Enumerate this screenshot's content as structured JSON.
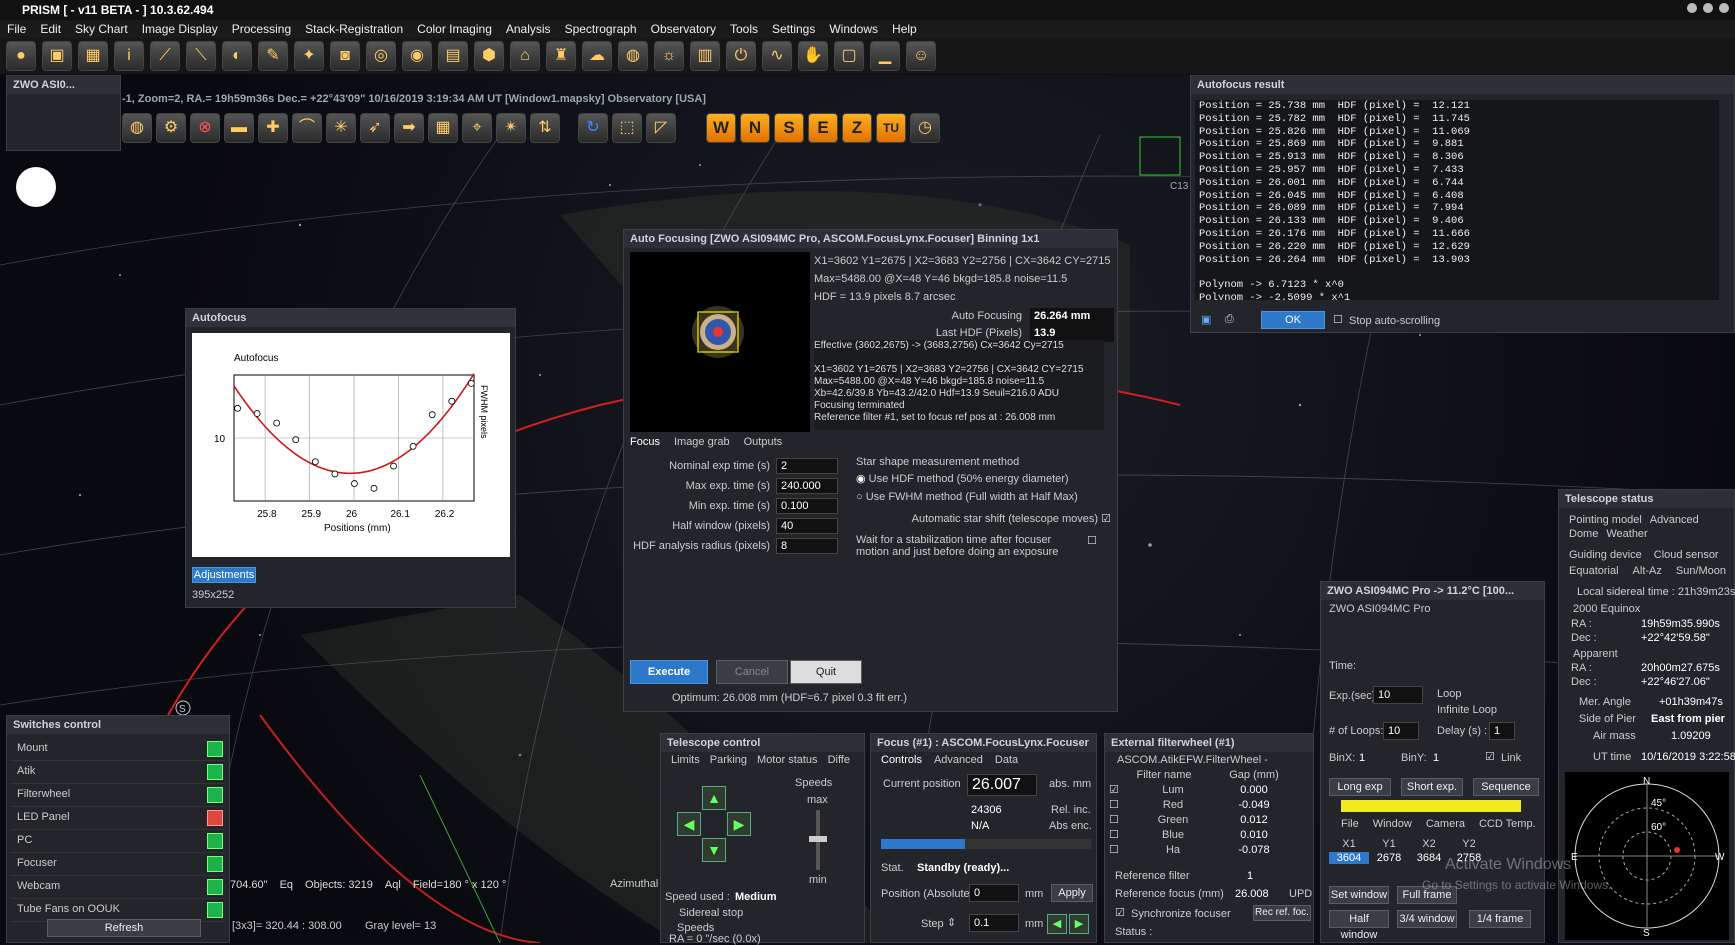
{
  "app": {
    "title": "PRISM [ - v11 BETA - ] 10.3.62.494"
  },
  "menu": [
    "File",
    "Edit",
    "Sky Chart",
    "Image Display",
    "Processing",
    "Stack-Registration",
    "Color Imaging",
    "Analysis",
    "Spectrograph",
    "Observatory",
    "Tools",
    "Settings",
    "Windows",
    "Help"
  ],
  "skychart": {
    "header": "-1, Zoom=2, RA.= 19h59m36s Dec.= +22°43'09\"  10/16/2019 3:19:34 AM UT [Window1.mapsky]  Observatory [USA]",
    "small_window_title": "ZWO ASI0...",
    "nav_letters": [
      "W",
      "N",
      "S",
      "E",
      "Z",
      "TU"
    ],
    "status": {
      "coord": "704.60\"",
      "proj": "Eq",
      "objects": "Objects: 3219",
      "aql": "Aql",
      "field": "Field=180 ° x 120 °",
      "azimuthal": "Azimuthal r",
      "xy": "[3x3]= 320.44 : 308.00",
      "gray": "Gray level= 13"
    },
    "label_c13": "C13",
    "label_s": "S"
  },
  "autofocus_plot": {
    "title": "Autofocus",
    "size": "395x252",
    "adjust_button": "Adjustments"
  },
  "chart_data": {
    "type": "scatter",
    "title": "Autofocus",
    "xlabel": "Positions (mm)",
    "ylabel": "FWHM pixels",
    "x": [
      25.738,
      25.782,
      25.826,
      25.869,
      25.913,
      25.957,
      26.001,
      26.045,
      26.089,
      26.133,
      26.176,
      26.22,
      26.264
    ],
    "y": [
      12.121,
      11.745,
      11.069,
      9.881,
      8.306,
      7.433,
      6.744,
      6.408,
      7.994,
      9.406,
      11.666,
      12.629,
      13.903
    ],
    "fit_curve": true,
    "xlim": [
      25.73,
      26.27
    ],
    "ylim": [
      5.5,
      14.5
    ],
    "xticks": [
      "25.8",
      "25.9",
      "26",
      "26.1",
      "26.2"
    ],
    "yticks": [
      "10"
    ]
  },
  "autofocus_dialog": {
    "title": "Auto Focusing [ZWO ASI094MC Pro, ASCOM.FocusLynx.Focuser] Binning 1x1",
    "info1": "X1=3602 Y1=2675 | X2=3683 Y2=2756 | CX=3642  CY=2715",
    "info2": "Max=5488.00  @X=48 Y=46  bkgd=185.8  noise=11.5",
    "info3": "HDF = 13.9 pixels  8.7 arcsec",
    "auto_label": "Auto Focusing",
    "auto_value": "26.264 mm",
    "hdf_label": "Last HDF (Pixels)",
    "hdf_value": "13.9",
    "log": [
      "Effective (3602,2675) -> (3683,2756) Cx=3642 Cy=2715",
      "",
      "X1=3602 Y1=2675 | X2=3683 Y2=2756 | CX=3642  CY=2715",
      "Max=5488.00  @X=48 Y=46  bkgd=185.8  noise=11.5",
      "Xb=42.6/39.8  Yb=43.2/42.0  Hdf=13.9  Seuil=216.0 ADU",
      "Focusing terminated",
      "Reference filter #1, set to focus ref pos at : 26.008 mm"
    ],
    "tabs": [
      "Focus",
      "Image grab",
      "Outputs"
    ],
    "params": [
      {
        "label": "Nominal exp time (s)",
        "value": "2"
      },
      {
        "label": "Max exp. time (s)",
        "value": "240.000"
      },
      {
        "label": "Min exp. time (s)",
        "value": "0.100"
      },
      {
        "label": "Half window (pixels)",
        "value": "40"
      },
      {
        "label": "HDF analysis radius (pixels)",
        "value": "8"
      }
    ],
    "method_title": "Star shape measurement method",
    "method_hdf": "Use HDF method (50% energy diameter)",
    "method_fwhm": "Use FWHM method (Full width at Half Max)",
    "auto_shift": "Automatic star shift (telescope moves)",
    "wait_text": "Wait for a stabilization time after focuser motion and just before doing an exposure",
    "execute": "Execute",
    "cancel": "Cancel",
    "quit": "Quit",
    "optimum": "Optimum: 26.008 mm (HDF=6.7 pixel 0.3 fit err.)"
  },
  "autofocus_result": {
    "title": "Autofocus result",
    "lines": [
      "Position = 25.738 mm  HDF (pixel) =  12.121",
      "Position = 25.782 mm  HDF (pixel) =  11.745",
      "Position = 25.826 mm  HDF (pixel) =  11.069",
      "Position = 25.869 mm  HDF (pixel) =  9.881",
      "Position = 25.913 mm  HDF (pixel) =  8.306",
      "Position = 25.957 mm  HDF (pixel) =  7.433",
      "Position = 26.001 mm  HDF (pixel) =  6.744",
      "Position = 26.045 mm  HDF (pixel) =  6.408",
      "Position = 26.089 mm  HDF (pixel) =  7.994",
      "Position = 26.133 mm  HDF (pixel) =  9.406",
      "Position = 26.176 mm  HDF (pixel) =  11.666",
      "Position = 26.220 mm  HDF (pixel) =  12.629",
      "Position = 26.264 mm  HDF (pixel) =  13.903",
      "",
      "Polynom -> 6.7123 * x^0",
      "Polynom -> -2.5099 * x^1"
    ],
    "ok": "OK",
    "stop_scroll": "Stop auto-scrolling"
  },
  "switches": {
    "title": "Switches control",
    "items": [
      {
        "name": "Mount",
        "state": "on"
      },
      {
        "name": "Atik",
        "state": "on"
      },
      {
        "name": "Filterwheel",
        "state": "on"
      },
      {
        "name": "LED Panel",
        "state": "off"
      },
      {
        "name": "PC",
        "state": "on"
      },
      {
        "name": "Focuser",
        "state": "on"
      },
      {
        "name": "Webcam",
        "state": "on"
      },
      {
        "name": "Tube Fans on OOUK",
        "state": "on"
      }
    ],
    "refresh": "Refresh"
  },
  "telescope_control": {
    "title": "Telescope control",
    "tabs": [
      "Limits",
      "Parking",
      "Motor status",
      "Diffe"
    ],
    "speeds": "Speeds",
    "max": "max",
    "min": "min",
    "speed_used_label": "Speed used :",
    "speed_used": "Medium",
    "sidereal": "Sidereal stop",
    "speeds2": "Speeds",
    "ra": "RA = 0 \"/sec (0.0x)"
  },
  "focus_panel": {
    "title": "Focus (#1) : ASCOM.FocusLynx.Focuser",
    "tabs": [
      "Controls",
      "Advanced",
      "Data"
    ],
    "current_label": "Current position",
    "current_value": "26.007",
    "abs_unit": "abs. mm",
    "rel_value": "24306",
    "rel_label": "Rel. inc.",
    "na": "N/A",
    "abs_enc": "Abs enc.",
    "stat_label": "Stat.",
    "stat_value": "Standby (ready)...",
    "pos_label": "Position (Absolute)",
    "pos_value": "0",
    "mm": "mm",
    "apply": "Apply",
    "step_label": "Step",
    "step_value": "0.1",
    "step_unit": "mm"
  },
  "filterwheel": {
    "title": "External filterwheel (#1)",
    "device": "ASCOM.AtikEFW.FilterWheel -",
    "col_name": "Filter name",
    "col_gap": "Gap (mm)",
    "filters": [
      {
        "name": "Lum",
        "gap": "0.000"
      },
      {
        "name": "Red",
        "gap": "-0.049"
      },
      {
        "name": "Green",
        "gap": "0.012"
      },
      {
        "name": "Blue",
        "gap": "0.010"
      },
      {
        "name": "Ha",
        "gap": "-0.078"
      }
    ],
    "ref_filter_label": "Reference filter",
    "ref_filter_value": "1",
    "ref_focus_label": "Reference focus (mm)",
    "ref_focus_value": "26.008",
    "upd": "UPD",
    "sync": "Synchronize focuser",
    "rec": "Rec ref. foc.",
    "status": "Status :"
  },
  "camera": {
    "title": "ZWO ASI094MC Pro  -> 11.2°C  [100...",
    "name": "ZWO ASI094MC Pro",
    "time": "Time:",
    "exp_label": "Exp.(sec)",
    "exp_value": "10",
    "loop": "Loop",
    "infinite": "Infinite Loop",
    "loops_label": "# of Loops:",
    "loops_value": "10",
    "delay_label": "Delay (s) :",
    "delay_value": "1",
    "binx_label": "BinX:",
    "binx": "1",
    "biny_label": "BinY:",
    "biny": "1",
    "link": "Link",
    "long_exp": "Long exp",
    "short_exp": "Short exp.",
    "sequence": "Sequence",
    "tabs": [
      "File",
      "Window",
      "Camera",
      "CCD Temp."
    ],
    "coord_headers": [
      "X1",
      "Y1",
      "X2",
      "Y2"
    ],
    "coord_values": [
      "3604",
      "2678",
      "3684",
      "2758"
    ],
    "set_window": "Set window",
    "full_frame": "Full frame",
    "half_window": "Half window",
    "three_quarter": "3/4 window",
    "quarter": "1/4 frame"
  },
  "telescope_status": {
    "title": "Telescope status",
    "tabs_row1": [
      "Pointing model",
      "Advanced",
      "Dome",
      "Weather"
    ],
    "tabs_row2": [
      "Guiding device",
      "Cloud sensor"
    ],
    "tabs_row3": [
      "Equatorial",
      "Alt-Az",
      "Sun/Moon"
    ],
    "lst": "Local sidereal time : 21h39m23s",
    "equinox": "2000 Equinox",
    "ra_label": "RA :",
    "ra_value": "19h59m35.990s",
    "dec_label": "Dec :",
    "dec_value": "+22°42'59.58\"",
    "apparent": "Apparent",
    "ra2_value": "20h00m27.675s",
    "dec2_value": "+22°46'27.06\"",
    "mer_label": "Mer. Angle",
    "mer_value": "+01h39m47s",
    "pier_label": "Side of Pier",
    "pier_value": "East from pier",
    "airmass_label": "Air mass",
    "airmass_value": "1.09209",
    "ut_label": "UT time",
    "ut_value": "10/16/2019 3:22:58",
    "compass": [
      "N",
      "S",
      "E",
      "W",
      "45°",
      "60°"
    ]
  },
  "watermark": {
    "line1": "Activate Windows",
    "line2": "Go to Settings to activate Windows."
  }
}
